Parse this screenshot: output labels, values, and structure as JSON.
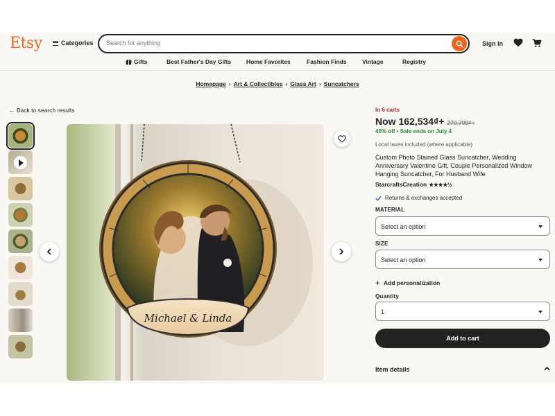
{
  "header": {
    "logo": "Etsy",
    "categories_label": "Categories",
    "search_placeholder": "Search for anything",
    "signin_label": "Sign in"
  },
  "nav": {
    "items": [
      {
        "label": "Gifts",
        "icon": "gift-icon"
      },
      {
        "label": "Best Father's Day Gifts"
      },
      {
        "label": "Home Favorites"
      },
      {
        "label": "Fashion Finds"
      },
      {
        "label": "Vintage"
      },
      {
        "label": "Registry"
      }
    ]
  },
  "breadcrumb": [
    "Homepage",
    "Art & Collectibles",
    "Glass Art",
    "Suncatchers"
  ],
  "back_label": "← Back to search results",
  "gallery": {
    "main_caption": "Michael & Linda",
    "thumbnail_count": 9
  },
  "product": {
    "carts_notice": "In 6 carts",
    "price": "Now 162,534₫+",
    "old_price": "270,799₫+",
    "sale_text": "40% off  •  Sale ends on July 4",
    "tax_note": "Local taxes included (where applicable)",
    "title": "Custom Photo Stained Glass Suncatcher, Wedding Anniversary Valentine Gift, Couple Personalized Window Hanging Suncatcher, For Husband Wife",
    "shop_name": "StarcraftsCreation",
    "rating_stars": "★★★★½",
    "returns": "Returns & exchanges accepted",
    "material_label": "MATERIAL",
    "material_value": "Select an option",
    "size_label": "SIZE",
    "size_value": "Select an option",
    "add_personalization": "Add personalization",
    "quantity_label": "Quantity",
    "quantity_value": "1",
    "add_to_cart": "Add to cart",
    "item_details": "Item details"
  },
  "colors": {
    "brand": "#f1641e",
    "sale_green": "#258635",
    "alert_red": "#b3261e",
    "button_dark": "#222222"
  }
}
